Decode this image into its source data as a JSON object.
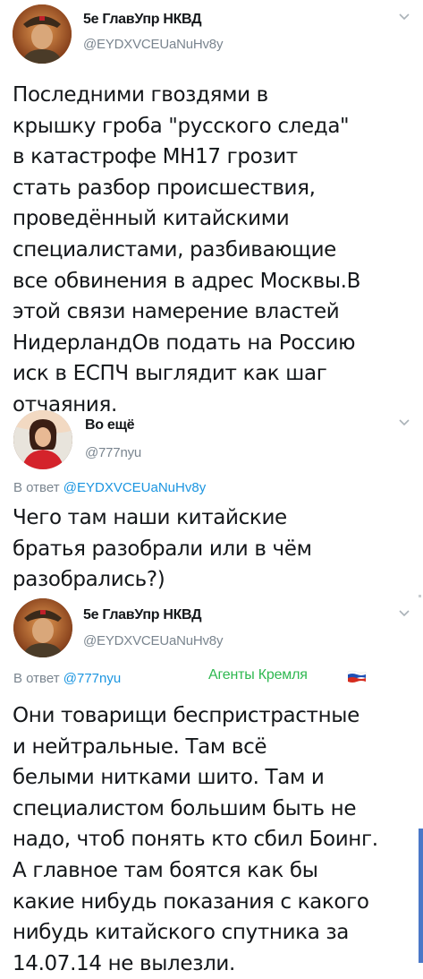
{
  "tweets": [
    {
      "name": "5е ГлавУпр НКВД",
      "handle": "@EYDXVCEUaNuHv8y",
      "reply_prefix": "",
      "reply_to": "",
      "text": "Последними гвоздями в\nкрышку гроба \"русского следа\"\nв катастрофе МН17 грозит\nстать разбор происшествия,\nпроведённый китайскими\nспециалистами, разбивающие\nвсе обвинения в адрес Москвы.В\nэтой связи намерение властей\nНидерландОв подать на Россию\nиск в ЕСПЧ выглядит как шаг\nотчаяния."
    },
    {
      "name": "Во ещё",
      "handle": "@777nyu",
      "reply_prefix": "В ответ",
      "reply_to": "@EYDXVCEUaNuHv8y",
      "text": "Чего там наши китайские\nбратья разобрали или в чём\nразобрались?)"
    },
    {
      "name": "5е ГлавУпр НКВД",
      "handle": "@EYDXVCEUaNuHv8y",
      "reply_prefix": "В ответ",
      "reply_to": "@777nyu",
      "tag": "Агенты Кремля",
      "text": "Они товарищи беспристрастные\nи нейтральные. Там всё\nбелыми нитками шито. Там и\nспециалистом большим быть не\nнадо, чтоб понять кто сбил Боинг.\nА главное там боятся  как бы\nкакие нибудь показания с какого\nнибудь китайского спутника за\n14.07.14 не вылезли."
    }
  ],
  "icons": {
    "avatar_1": "soldier-avatar",
    "avatar_2": "woman-avatar",
    "avatar_3": "soldier-avatar",
    "menu": "chevron-down-icon",
    "flag": "russian-flag-icon"
  },
  "colors": {
    "text": "#14171a",
    "secondary": "#7a858f",
    "link": "#1b95e0",
    "tag": "#2eb850"
  }
}
